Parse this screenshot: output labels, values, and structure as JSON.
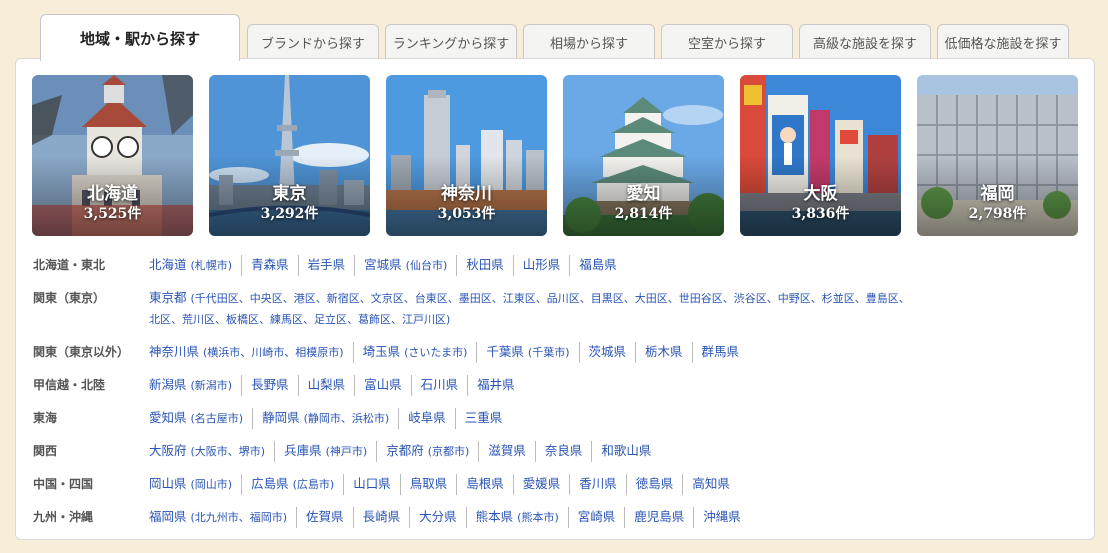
{
  "tabs": [
    {
      "label": "地域・駅から探す",
      "active": true
    },
    {
      "label": "ブランドから探す"
    },
    {
      "label": "ランキングから探す"
    },
    {
      "label": "相場から探す"
    },
    {
      "label": "空室から探す"
    },
    {
      "label": "高級な施設を探す"
    },
    {
      "label": "低価格な施設を探す"
    }
  ],
  "cards": [
    {
      "name": "北海道",
      "count": "3,525件"
    },
    {
      "name": "東京",
      "count": "3,292件"
    },
    {
      "name": "神奈川",
      "count": "3,053件"
    },
    {
      "name": "愛知",
      "count": "2,814件"
    },
    {
      "name": "大阪",
      "count": "3,836件"
    },
    {
      "name": "福岡",
      "count": "2,798件"
    }
  ],
  "regions": [
    {
      "label": "北海道・東北",
      "links": [
        {
          "main": "北海道",
          "sub": "(札幌市)"
        },
        {
          "main": "青森県"
        },
        {
          "main": "岩手県"
        },
        {
          "main": "宮城県",
          "sub": "(仙台市)"
        },
        {
          "main": "秋田県"
        },
        {
          "main": "山形県"
        },
        {
          "main": "福島県"
        }
      ]
    },
    {
      "label": "関東（東京）",
      "links": [
        {
          "main": "東京都",
          "sub": "(千代田区、中央区、港区、新宿区、文京区、台東区、墨田区、江東区、品川区、目黒区、大田区、世田谷区、渋谷区、中野区、杉並区、豊島区、"
        },
        {
          "main": "",
          "sub": "北区、荒川区、板橋区、練馬区、足立区、葛飾区、江戸川区)"
        }
      ]
    },
    {
      "label": "関東（東京以外）",
      "links": [
        {
          "main": "神奈川県",
          "sub": "(横浜市、川崎市、相模原市)"
        },
        {
          "main": "埼玉県",
          "sub": "(さいたま市)"
        },
        {
          "main": "千葉県",
          "sub": "(千葉市)"
        },
        {
          "main": "茨城県"
        },
        {
          "main": "栃木県"
        },
        {
          "main": "群馬県"
        }
      ]
    },
    {
      "label": "甲信越・北陸",
      "links": [
        {
          "main": "新潟県",
          "sub": "(新潟市)"
        },
        {
          "main": "長野県"
        },
        {
          "main": "山梨県"
        },
        {
          "main": "富山県"
        },
        {
          "main": "石川県"
        },
        {
          "main": "福井県"
        }
      ]
    },
    {
      "label": "東海",
      "links": [
        {
          "main": "愛知県",
          "sub": "(名古屋市)"
        },
        {
          "main": "静岡県",
          "sub": "(静岡市、浜松市)"
        },
        {
          "main": "岐阜県"
        },
        {
          "main": "三重県"
        }
      ]
    },
    {
      "label": "関西",
      "links": [
        {
          "main": "大阪府",
          "sub": "(大阪市、堺市)"
        },
        {
          "main": "兵庫県",
          "sub": "(神戸市)"
        },
        {
          "main": "京都府",
          "sub": "(京都市)"
        },
        {
          "main": "滋賀県"
        },
        {
          "main": "奈良県"
        },
        {
          "main": "和歌山県"
        }
      ]
    },
    {
      "label": "中国・四国",
      "links": [
        {
          "main": "岡山県",
          "sub": "(岡山市)"
        },
        {
          "main": "広島県",
          "sub": "(広島市)"
        },
        {
          "main": "山口県"
        },
        {
          "main": "鳥取県"
        },
        {
          "main": "島根県"
        },
        {
          "main": "愛媛県"
        },
        {
          "main": "香川県"
        },
        {
          "main": "徳島県"
        },
        {
          "main": "高知県"
        }
      ]
    },
    {
      "label": "九州・沖縄",
      "links": [
        {
          "main": "福岡県",
          "sub": "(北九州市、福岡市)"
        },
        {
          "main": "佐賀県"
        },
        {
          "main": "長崎県"
        },
        {
          "main": "大分県"
        },
        {
          "main": "熊本県",
          "sub": "(熊本市)"
        },
        {
          "main": "宮崎県"
        },
        {
          "main": "鹿児島県"
        },
        {
          "main": "沖縄県"
        }
      ]
    }
  ]
}
